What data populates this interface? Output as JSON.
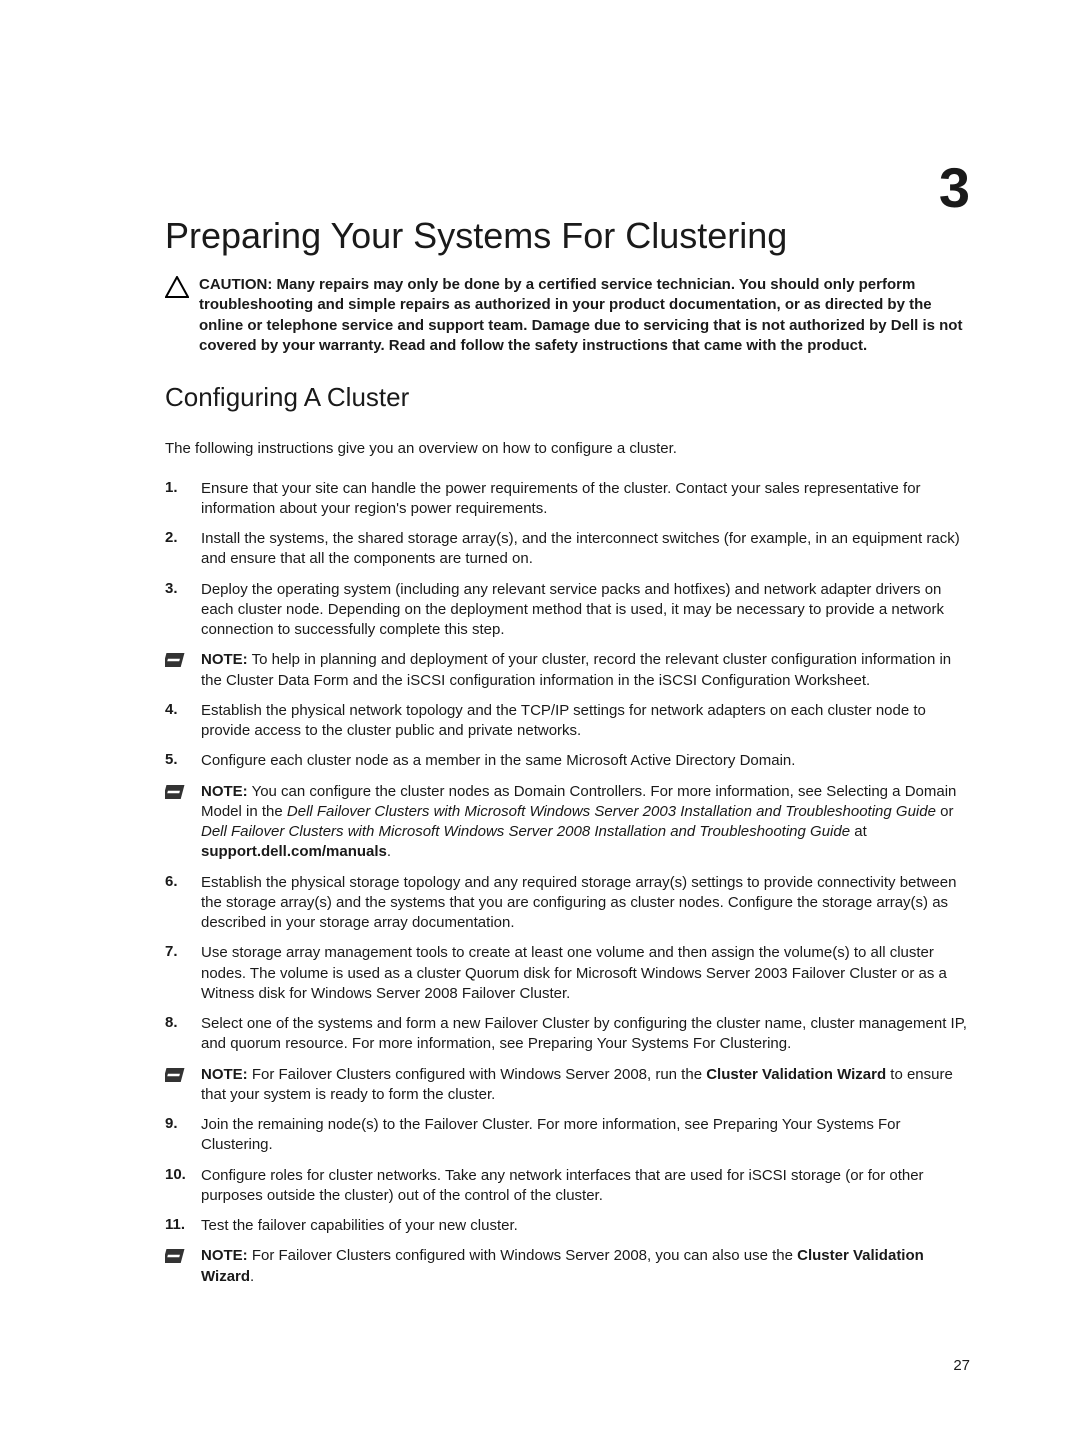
{
  "chapter": {
    "number": "3",
    "title": "Preparing Your Systems For Clustering"
  },
  "caution": {
    "label": "CAUTION:",
    "text": "Many repairs may only be done by a certified service technician. You should only perform troubleshooting and simple repairs as authorized in your product documentation, or as directed by the online or telephone service and support team. Damage due to servicing that is not authorized by Dell is not covered by your warranty. Read and follow the safety instructions that came with the product."
  },
  "section": {
    "title": "Configuring A Cluster",
    "intro": "The following instructions give you an overview on how to configure a cluster."
  },
  "steps": {
    "s1": {
      "num": "1.",
      "text": "Ensure that your site can handle the power requirements of the cluster. Contact your sales representative for information about your region's power requirements."
    },
    "s2": {
      "num": "2.",
      "text": "Install the systems, the shared storage array(s), and the interconnect switches (for example, in an equipment rack) and ensure that all the components are turned on."
    },
    "s3": {
      "num": "3.",
      "text": "Deploy the operating system (including any relevant service packs and hotfixes) and network adapter drivers on each cluster node. Depending on the deployment method that is used, it may be necessary to provide a network connection to successfully complete this step."
    },
    "s4": {
      "num": "4.",
      "text": "Establish the physical network topology and the TCP/IP settings for network adapters on each cluster node to provide access to the cluster public and private networks."
    },
    "s5": {
      "num": "5.",
      "text": "Configure each cluster node as a member in the same Microsoft Active Directory Domain."
    },
    "s6": {
      "num": "6.",
      "text": "Establish the physical storage topology and any required storage array(s) settings to provide connectivity between the storage array(s) and the systems that you are configuring as cluster nodes. Configure the storage array(s) as described in your storage array documentation."
    },
    "s7": {
      "num": "7.",
      "text": "Use storage array management tools to create at least one volume and then assign the volume(s) to all cluster nodes. The volume is used as a cluster Quorum disk for Microsoft Windows Server 2003 Failover Cluster or as a Witness disk for Windows Server 2008 Failover Cluster."
    },
    "s8": {
      "num": "8.",
      "text": "Select one of the systems and form a new Failover Cluster by configuring the cluster name, cluster management IP, and quorum resource. For more information, see Preparing Your Systems For Clustering."
    },
    "s9": {
      "num": "9.",
      "text": "Join the remaining node(s) to the Failover Cluster. For more information, see Preparing Your Systems For Clustering."
    },
    "s10": {
      "num": "10.",
      "text": "Configure roles for cluster networks. Take any network interfaces that are used for iSCSI storage (or for other purposes outside the cluster) out of the control of the cluster."
    },
    "s11": {
      "num": "11.",
      "text": "Test the failover capabilities of your new cluster."
    }
  },
  "notes": {
    "n1": {
      "label": "NOTE:",
      "text": "To help in planning and deployment of your cluster, record the relevant cluster configuration information in the Cluster Data Form and the iSCSI configuration information in the iSCSI Configuration Worksheet."
    },
    "n2": {
      "label": "NOTE:",
      "prefix": "You can configure the cluster nodes as Domain Controllers. For more information, see Selecting a Domain Model in the ",
      "italic1": "Dell Failover Clusters with Microsoft Windows Server 2003 Installation and Troubleshooting Guide",
      "mid1": " or ",
      "italic2": "Dell Failover Clusters with Microsoft Windows Server 2008 Installation and Troubleshooting Guide",
      "mid2": " at ",
      "bold1": "support.dell.com/manuals",
      "suffix": "."
    },
    "n3": {
      "label": "NOTE:",
      "prefix": "For Failover Clusters configured with Windows Server 2008, run the ",
      "bold1": "Cluster Validation Wizard",
      "suffix": " to ensure that your system is ready to form the cluster."
    },
    "n4": {
      "label": "NOTE:",
      "prefix": "For Failover Clusters configured with Windows Server 2008, you can also use the ",
      "bold1": "Cluster Validation Wizard",
      "suffix": "."
    }
  },
  "pageNumber": "27"
}
